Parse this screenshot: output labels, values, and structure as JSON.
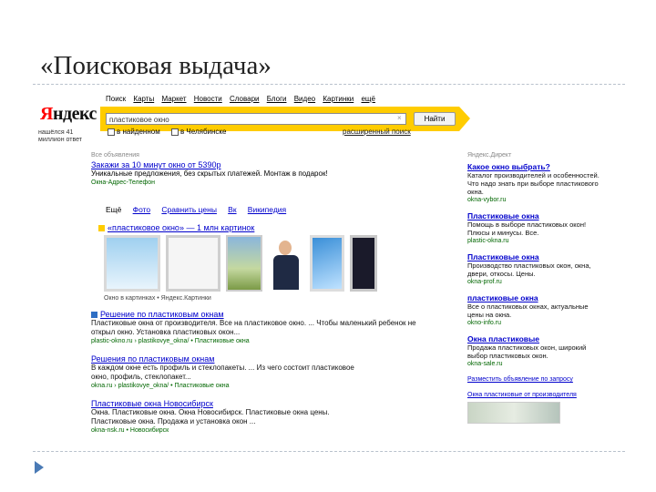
{
  "slide": {
    "title": "«Поисковая выдача»"
  },
  "serp": {
    "logo": {
      "first_letter": "Я",
      "rest": "ндекс",
      "subtitle": "нашёлся 41 миллион ответ"
    },
    "services": [
      "Поиск",
      "Карты",
      "Маркет",
      "Новости",
      "Словари",
      "Блоги",
      "Видео",
      "Картинки",
      "ещё"
    ],
    "search": {
      "query": "пластиковое окно",
      "button": "Найти",
      "options": [
        "в найденном",
        "в Челябинске"
      ],
      "advanced": "расширенный поиск"
    },
    "ad": {
      "head": "Все объявления",
      "title": "Закажи за 10 минут окно от 5390р",
      "text": "Уникальные предложения, без скрытых платежей. Монтаж в подарок!",
      "url": "Окна-Адрес-Телефон"
    },
    "vertical_tabs": [
      "Ещё",
      "Фото",
      "Сравнить цены",
      "Вк",
      "Википедия"
    ],
    "image_block": {
      "title": "«пластиковое окно» — 1 млн картинок",
      "caption": "Окно в картинках • Яндекс.Картинки"
    },
    "results": [
      {
        "title": "Решение по пластиковым окнам",
        "text": [
          "Пластиковые окна от производителя. Все на пластиковое окно. ... Чтобы маленький ребенок не",
          "открыл окно. Установка пластиковых окон..."
        ],
        "url": "plastic-okno.ru › plastikovye_okna/ • Пластиковые окна"
      },
      {
        "title": "Решения по пластиковым окнам",
        "text": [
          "В каждом окне есть профиль и стеклопакеты. ... Из чего состоит пластиковое",
          "окно, профиль, стеклопакет..."
        ],
        "url": "okna.ru › plastikovye_okna/ • Пластиковые окна"
      },
      {
        "title": "Пластиковые окна Новосибирск",
        "text": [
          "Окна. Пластиковые окна. Окна Новосибирск. Пластиковые окна цены.",
          "Пластиковые окна. Продажа и установка окон ..."
        ],
        "url": "okna-nsk.ru • Новосибирск"
      }
    ],
    "sidebar": {
      "head": "Яндекс.Директ",
      "items": [
        {
          "title": "Какое окно выбрать?",
          "text": "Каталог производителей и особенностей. Что надо знать при выборе пластикового окна.",
          "url": "okna-vybor.ru"
        },
        {
          "title": "Пластиковые окна",
          "text": "Помощь в выборе пластиковых окон! Плюсы и минусы. Все.",
          "url": "plastic-okna.ru"
        },
        {
          "title": "Пластиковые окна",
          "text": "Производство пластиковых окон, окна, двери, откосы. Цены.",
          "url": "okna-prof.ru"
        },
        {
          "title": "пластиковые окна",
          "text": "Все о пластиковых окнах, актуальные цены на окна.",
          "url": "okno-info.ru"
        },
        {
          "title": "Окна пластиковые",
          "text": "Продажа пластиковых окон, широкий выбор пластиковых окон.",
          "url": "okna-sale.ru"
        }
      ],
      "footer_link": "Разместить объявление по запросу",
      "bottom": "Окна пластиковые от производителя"
    }
  }
}
